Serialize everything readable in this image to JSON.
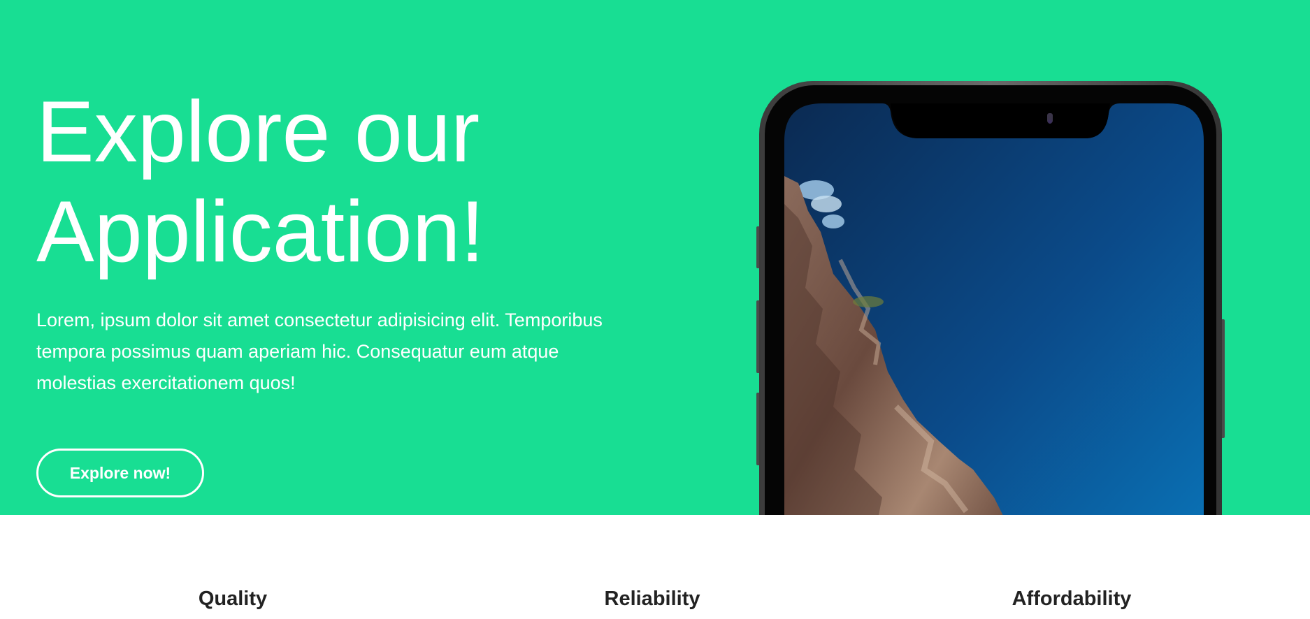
{
  "hero": {
    "title": "Explore our Application!",
    "text": "Lorem, ipsum dolor sit amet consectetur adipisicing elit. Temporibus tempora possimus quam aperiam hic. Consequatur eum atque molestias exercitationem quos!",
    "button_label": "Explore now!",
    "background_color": "#18de93"
  },
  "phone_image": {
    "icon": "smartphone-mockup-icon"
  },
  "features": [
    {
      "title": "Quality"
    },
    {
      "title": "Reliability"
    },
    {
      "title": "Affordability"
    }
  ]
}
